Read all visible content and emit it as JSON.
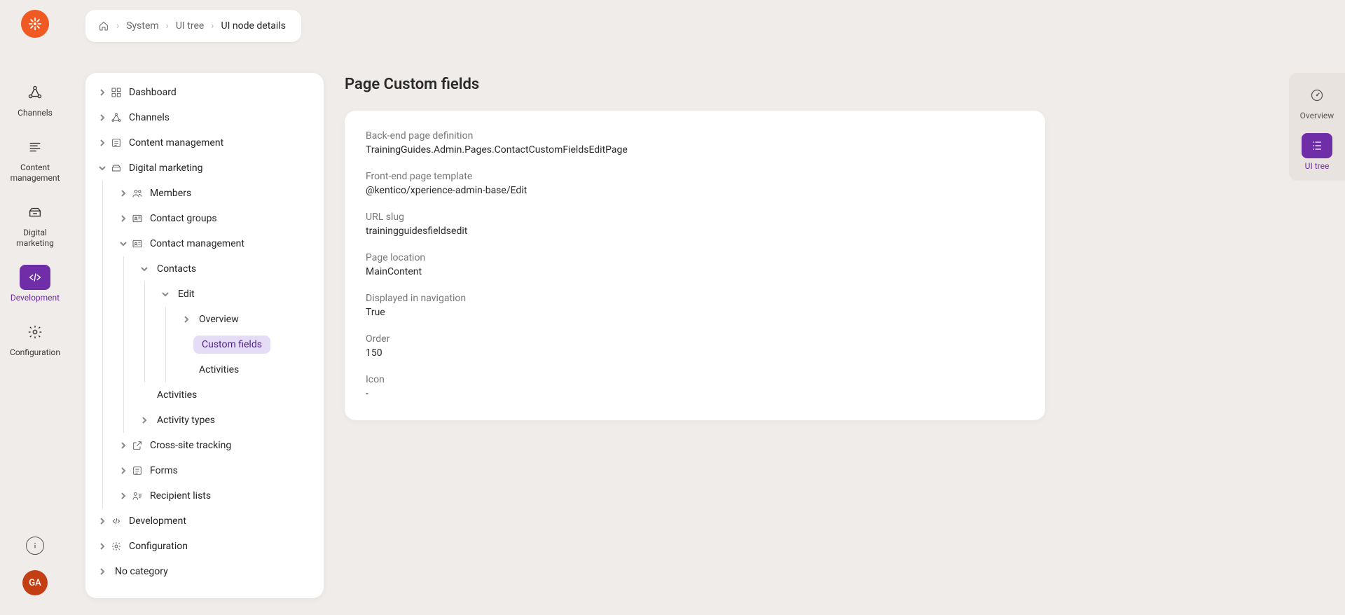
{
  "breadcrumb": {
    "items": [
      "System",
      "UI tree",
      "UI node details"
    ]
  },
  "leftRail": {
    "items": [
      {
        "label": "Channels"
      },
      {
        "label": "Content management"
      },
      {
        "label": "Digital marketing"
      },
      {
        "label": "Development"
      },
      {
        "label": "Configuration"
      }
    ],
    "avatar": "GA"
  },
  "rightRail": {
    "items": [
      {
        "label": "Overview"
      },
      {
        "label": "UI tree"
      }
    ]
  },
  "tree": {
    "dashboard": "Dashboard",
    "channels": "Channels",
    "contentManagement": "Content management",
    "digitalMarketing": "Digital marketing",
    "members": "Members",
    "contactGroups": "Contact groups",
    "contactManagement": "Contact management",
    "contacts": "Contacts",
    "edit": "Edit",
    "overview": "Overview",
    "customFields": "Custom fields",
    "activitiesChild": "Activities",
    "activities": "Activities",
    "activityTypes": "Activity types",
    "crossSiteTracking": "Cross-site tracking",
    "forms": "Forms",
    "recipientLists": "Recipient lists",
    "development": "Development",
    "configuration": "Configuration",
    "noCategory": "No category"
  },
  "page": {
    "title": "Page Custom fields",
    "fields": [
      {
        "label": "Back-end page definition",
        "value": "TrainingGuides.Admin.Pages.ContactCustomFieldsEditPage"
      },
      {
        "label": "Front-end page template",
        "value": "@kentico/xperience-admin-base/Edit"
      },
      {
        "label": "URL slug",
        "value": "trainingguidesfieldsedit"
      },
      {
        "label": "Page location",
        "value": "MainContent"
      },
      {
        "label": "Displayed in navigation",
        "value": "True"
      },
      {
        "label": "Order",
        "value": "150"
      },
      {
        "label": "Icon",
        "value": "-"
      }
    ]
  }
}
